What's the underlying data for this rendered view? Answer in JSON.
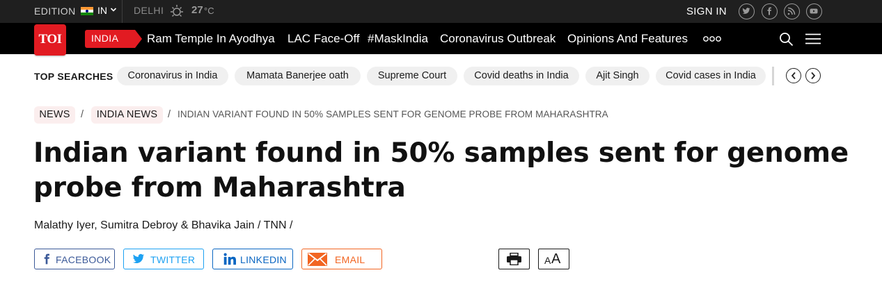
{
  "topbar": {
    "edition_label": "EDITION",
    "edition_code": "IN",
    "city": "DELHI",
    "temperature": "27",
    "temperature_unit": "°C",
    "sign_in": "SIGN IN",
    "social_icons": [
      "twitter-icon",
      "facebook-icon",
      "rss-icon",
      "youtube-icon"
    ]
  },
  "logo": {
    "text": "TOI",
    "color": "#e21b22"
  },
  "nav": {
    "section": "INDIA",
    "links": [
      "Ram Temple In Ayodhya",
      "LAC Face-Off",
      "#MaskIndia",
      "Coronavirus Outbreak",
      "Opinions And Features"
    ]
  },
  "top_searches": {
    "label": "TOP SEARCHES",
    "items": [
      "Coronavirus in India",
      "Mamata Banerjee oath",
      "Supreme Court",
      "Covid deaths in India",
      "Ajit Singh",
      "Covid cases in India"
    ]
  },
  "breadcrumb": {
    "items": [
      "NEWS",
      "INDIA NEWS"
    ],
    "separator": "/",
    "current": "INDIAN VARIANT FOUND IN 50% SAMPLES SENT FOR GENOME PROBE FROM MAHARASHTRA"
  },
  "article": {
    "headline_line1": "Indian variant found in 50% samples sent for genome",
    "headline_line2": "probe from Maharashtra",
    "byline": "Malathy Iyer, Sumitra Debroy & Bhavika Jain / TNN /"
  },
  "share": {
    "facebook": "FACEBOOK",
    "twitter": "TWITTER",
    "linkedin": "LINKEDIN",
    "email": "EMAIL"
  },
  "tools": {
    "font_size_small": "A",
    "font_size_large": "A"
  },
  "colors": {
    "brand_red": "#e21b22",
    "facebook": "#3b5998",
    "twitter": "#1da1f2",
    "linkedin": "#0a66c2",
    "email": "#f26522"
  }
}
